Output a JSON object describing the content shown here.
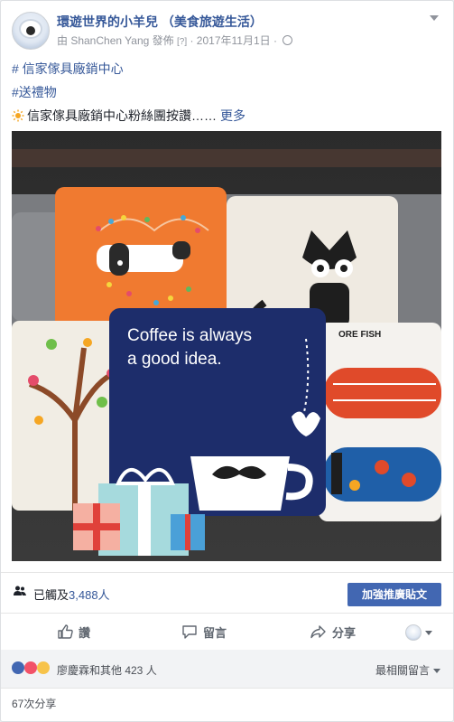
{
  "post": {
    "page_name": "環遊世界的小羊兒 （美食旅遊生活）",
    "meta_by": "由 ShanChen Yang 發佈",
    "meta_help": "[?]",
    "meta_sep": "·",
    "date": "2017年11月1日",
    "text_hashtag_1": "# 信家傢具廠銷中心",
    "text_hashtag_2": "#送禮物",
    "text_body": "信家傢具廠銷中心粉絲團按讚……",
    "see_more": "更多"
  },
  "photo": {
    "pillow_text_line1": "Coffee is always",
    "pillow_text_line2": "a good idea.",
    "pillow_text_fish": "ORE FISH"
  },
  "reach": {
    "label": "已觸及",
    "count": "3,488人",
    "boost_button": "加強推廣貼文"
  },
  "actions": {
    "like": "讚",
    "comment": "留言",
    "share": "分享"
  },
  "reactions": {
    "summary": "廖慶霖和其他 423 人",
    "sort_label": "最相關留言"
  },
  "shares": {
    "label": "67次分享"
  },
  "colors": {
    "link": "#365899",
    "button": "#4267b2",
    "like": "#4267b2",
    "love": "#f25268",
    "sad": "#f7c34a"
  }
}
